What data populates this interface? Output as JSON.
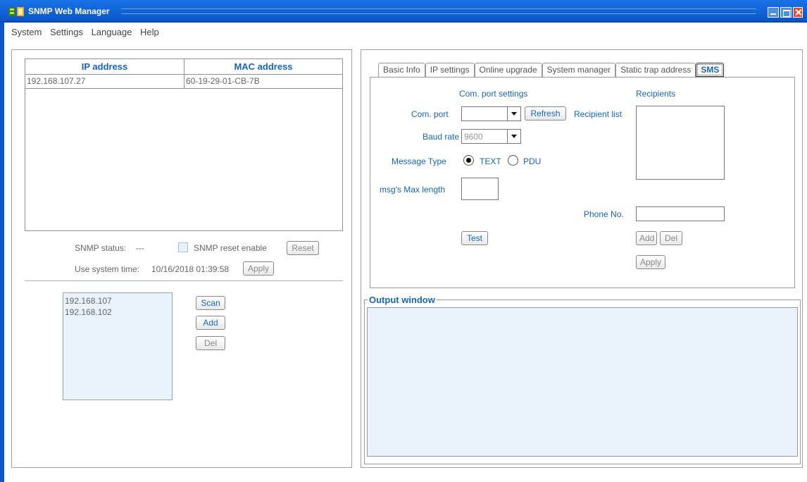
{
  "window": {
    "title": "SNMP Web Manager"
  },
  "menu": [
    "System",
    "Settings",
    "Language",
    "Help"
  ],
  "device_table": {
    "headers": [
      "IP address",
      "MAC address"
    ],
    "rows": [
      {
        "ip": "192.168.107.27",
        "mac": "60-19-29-01-CB-7B"
      }
    ]
  },
  "status": {
    "snmp_status_label": "SNMP status:",
    "snmp_status_value": "---",
    "reset_enable_label": "SNMP reset enable",
    "reset_button": "Reset",
    "system_time_label": "Use system time:",
    "system_time_value": "10/16/2018 01:39:58",
    "apply_button": "Apply"
  },
  "subnets": {
    "items": [
      "192.168.107",
      "192.168.102"
    ],
    "scan_button": "Scan",
    "add_button": "Add",
    "del_button": "Del"
  },
  "tabs": [
    "Basic Info",
    "IP settings",
    "Online upgrade",
    "System manager",
    "Static trap address",
    "SMS"
  ],
  "active_tab": "SMS",
  "sms": {
    "com_section_title": "Com. port settings",
    "recipients_title": "Recipients",
    "com_port_label": "Com. port",
    "com_port_value": "",
    "refresh_button": "Refresh",
    "recipient_list_label": "Recipient list",
    "baud_rate_label": "Baud rate",
    "baud_rate_value": "9600",
    "message_type_label": "Message Type",
    "message_type_text": "TEXT",
    "message_type_pdu": "PDU",
    "message_type_selected": "TEXT",
    "max_length_label": "msg's Max length",
    "max_length_value": "",
    "phone_label": "Phone No.",
    "phone_value": "",
    "test_button": "Test",
    "add_button": "Add",
    "del_button": "Del",
    "apply_button": "Apply"
  },
  "output": {
    "title": "Output window"
  },
  "colors": {
    "titlebar": "#0a55c7",
    "accent": "#1565c0",
    "list_bg": "#eaf2fb"
  }
}
